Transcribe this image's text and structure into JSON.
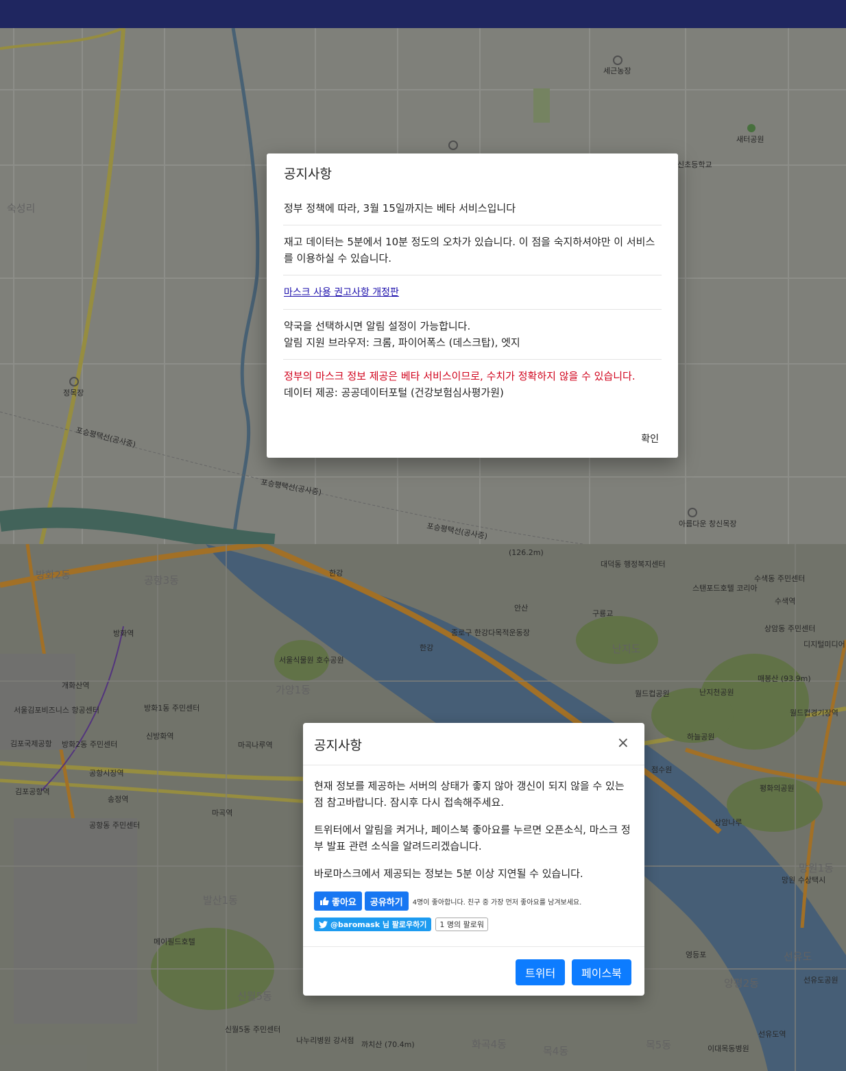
{
  "map_top": {
    "labels": [
      "세근농장",
      "새터공원",
      "신초등학교",
      "숙성리",
      "정목장",
      "포승평택선(공사중)",
      "포승평택선(공사중)",
      "포승평택선(공사중)",
      "아름다운 창신목장"
    ]
  },
  "map_bottom": {
    "labels": [
      "방화2동",
      "공항3동",
      "방화역",
      "개화산역",
      "서울김포비즈니스 항공센터",
      "김포국제공항",
      "방화2동 주민센터",
      "방화1동 주민센터",
      "신방화역",
      "마곡나루역",
      "공항시장역",
      "김포공항역",
      "송정역",
      "마곡역",
      "공항동 주민센터",
      "서울식물원 호수공원",
      "가양1동",
      "한강",
      "한강",
      "종로구 한강다목적운동장",
      "안산",
      "구룡교",
      "난지도",
      "대덕동 행정복지센터",
      "(126.2m)",
      "스탠포드호텔 코리아",
      "수색동 주민센터",
      "수색역",
      "상암동 주민센터",
      "디지털미디어",
      "매봉산 (93.9m)",
      "월드컵공원",
      "난지천공원",
      "하늘공원",
      "월드컵경기장역",
      "평화의공원",
      "상암나루",
      "망원1동",
      "망원 수상택시",
      "점수원",
      "발산1동",
      "메이필드호텔",
      "신월5동",
      "신월5동 주민센터",
      "나누리병원 강서점",
      "까치산 (70.4m)",
      "화곡4동",
      "목4동",
      "목5동",
      "이대목동병원",
      "선유도역",
      "선유도공원",
      "양평2동",
      "영등포",
      "선유도"
    ]
  },
  "notice_modal": {
    "title": "공지사항",
    "line1": "정부 정책에 따라, 3월 15일까지는 베타 서비스입니다",
    "line2": "재고 데이터는 5분에서 10분 정도의 오차가 있습니다. 이 점을 숙지하셔야만 이 서비스를 이용하실 수 있습니다.",
    "link": "마스크 사용 권고사항 개정판",
    "line4a": "약국을 선택하시면 알림 설정이 가능합니다.",
    "line4b": "알림 지원 브라우저: 크롬, 파이어폭스 (데스크탑), 엣지",
    "warning": "정부의 마스크 정보 제공은 베타 서비스이므로, 수치가 정확하지 않을 수 있습니다.",
    "source": "데이터 제공: 공공데이터포털 (건강보험심사평가원)",
    "confirm": "확인"
  },
  "server_modal": {
    "title": "공지사항",
    "close": "×",
    "p1": "현재 정보를 제공하는 서버의 상태가 좋지 않아 갱신이 되지 않을 수 있는 점 참고바랍니다. 잠시후 다시 접속해주세요.",
    "p2": "트위터에서 알림을 켜거나, 페이스북 좋아요를 누르면 오픈소식, 마스크 정부 발표 관련 소식을 알려드리겠습니다.",
    "p3": "바로마스크에서 제공되는 정보는 5분 이상 지연될 수 있습니다.",
    "fb_like": "좋아요",
    "fb_share": "공유하기",
    "fb_note": "4명이 좋아합니다. 친구 중 가장 먼저 좋아요를 남겨보세요.",
    "tw_follow": "@baromask 님 팔로우하기",
    "tw_count": "1 명의 팔로워",
    "btn_twitter": "트위터",
    "btn_facebook": "페이스북"
  },
  "colors": {
    "topbar": "#1f2660",
    "primary_button": "#0d7cff",
    "facebook": "#1877f2",
    "twitter": "#1d9bf0",
    "warning_text": "#d0021b"
  }
}
